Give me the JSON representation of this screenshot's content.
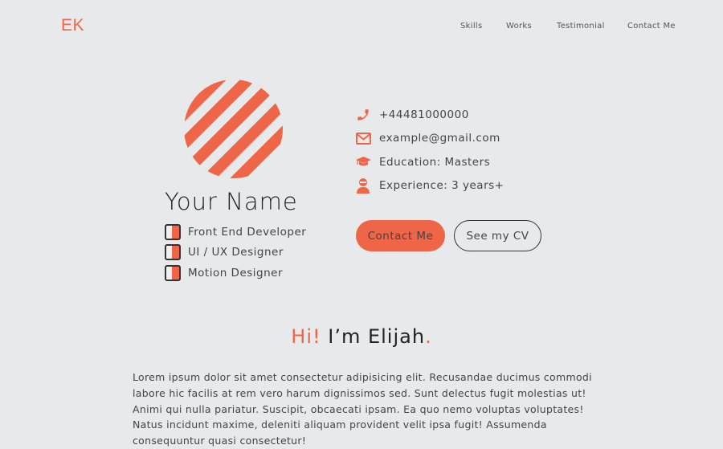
{
  "header": {
    "logo": "EK",
    "nav": [
      {
        "label": "Skills"
      },
      {
        "label": "Works"
      },
      {
        "label": "Testimonial"
      },
      {
        "label": "Contact Me"
      }
    ]
  },
  "profile": {
    "name": "Your Name",
    "roles": [
      {
        "label": "Front End Developer"
      },
      {
        "label": "UI / UX Designer"
      },
      {
        "label": "Motion Designer"
      }
    ]
  },
  "contacts": [
    {
      "icon": "phone-icon",
      "label": "+44481000000"
    },
    {
      "icon": "envelope-icon",
      "label": "example@gmail.com"
    },
    {
      "icon": "graduation-cap-icon",
      "label": "Education: Masters"
    },
    {
      "icon": "user-ninja-icon",
      "label": "Experience: 3 years+"
    }
  ],
  "actions": {
    "contact_label": "Contact Me",
    "cv_label": "See my CV"
  },
  "intro": {
    "greeting_accent": "Hi!",
    "greeting_main": " I’m Elijah",
    "greeting_dot": ".",
    "about": "Lorem ipsum dolor sit amet consectetur adipisicing elit. Recusandae ducimus commodi labore hic facilis at rem vero harum dignissimos sed. Sunt delectus fugit molestias ut! Animi qui nulla pariatur. Suscipit, obcaecati ipsam. Ea quo nemo voluptas voluptates! Natus incidunt maxime, deleniti aliquam provident velit ipsa fugit! Assumenda consequuntur quasi consectetur!"
  },
  "colors": {
    "accent": "#ef6548",
    "background": "#e8e9eb",
    "text": "#2b2b2b"
  }
}
